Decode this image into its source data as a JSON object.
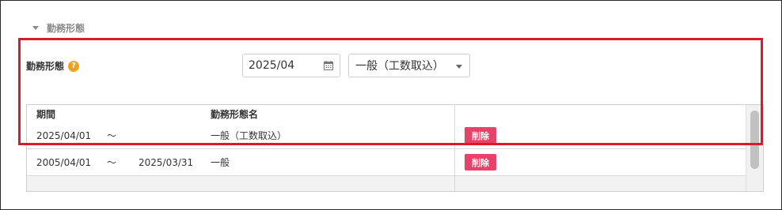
{
  "section": {
    "title": "勤務形態"
  },
  "field": {
    "label": "勤務形態",
    "help_glyph": "?"
  },
  "date_input": {
    "value": "2025/04"
  },
  "select": {
    "value": "一般（工数取込）"
  },
  "table": {
    "columns": [
      "期間",
      "勤務形態名",
      ""
    ],
    "rows": [
      {
        "start": "2025/04/01",
        "sep": "～",
        "end": "",
        "name": "一般（工数取込）",
        "action": "削除"
      },
      {
        "start": "2005/04/01",
        "sep": "～",
        "end": "2025/03/31",
        "name": "一般",
        "action": "削除"
      }
    ]
  },
  "colors": {
    "accent_red": "#e0162b",
    "delete_button": "#e8426a",
    "help_icon": "#f0a020"
  }
}
